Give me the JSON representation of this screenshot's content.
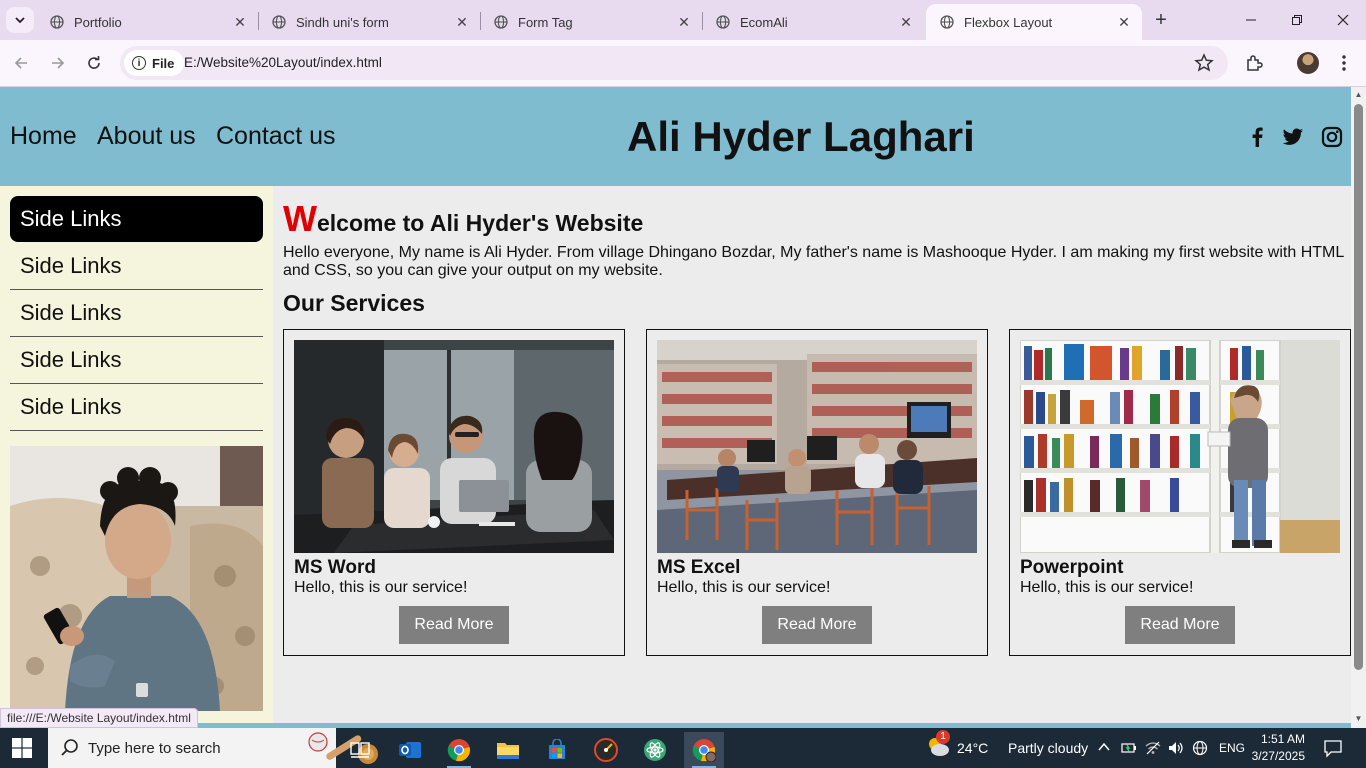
{
  "browser": {
    "tabs": [
      {
        "title": "Portfolio",
        "active": false
      },
      {
        "title": "Sindh uni's form",
        "active": false
      },
      {
        "title": "Form Tag",
        "active": false
      },
      {
        "title": "EcomAli",
        "active": false
      },
      {
        "title": "Flexbox Layout",
        "active": true
      }
    ],
    "omnibox": {
      "chip_label": "File",
      "url": "E:/Website%20Layout/index.html"
    },
    "status_url": "file:///E:/Website Layout/index.html"
  },
  "site": {
    "nav": [
      "Home",
      "About us",
      "Contact us"
    ],
    "title": "Ali Hyder Laghari",
    "social_icons": [
      "facebook-icon",
      "twitter-icon",
      "instagram-icon"
    ],
    "header_color": "#7fbccf",
    "sidebar": {
      "links": [
        "Side Links",
        "Side Links",
        "Side Links",
        "Side Links",
        "Side Links"
      ],
      "background": "#f5f4dc"
    },
    "welcome": {
      "first_letter": "W",
      "rest": "elcome to Ali Hyder's Website"
    },
    "intro": "Hello everyone, My name is Ali Hyder. From village Dhingano Bozdar, My father's name is Mashooque Hyder. I am making my first website with HTML and CSS, so you can give your output on my website.",
    "services_title": "Our Services",
    "cards": [
      {
        "title": "MS Word",
        "text": "Hello, this is our service!",
        "button": "Read More"
      },
      {
        "title": "MS Excel",
        "text": "Hello, this is our service!",
        "button": "Read More"
      },
      {
        "title": "Powerpoint",
        "text": "Hello, this is our service!",
        "button": "Read More"
      }
    ]
  },
  "taskbar": {
    "search_placeholder": "Type here to search",
    "weather": {
      "temp": "24°C",
      "condition": "Partly cloudy"
    },
    "language": "ENG",
    "time": "1:51 AM",
    "date": "3/27/2025",
    "weather_badge": "1"
  }
}
